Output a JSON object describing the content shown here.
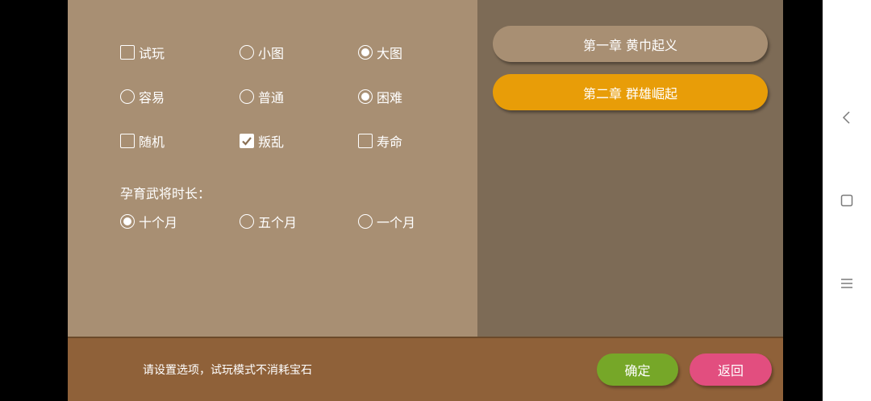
{
  "options": {
    "row1": [
      {
        "label": "试玩",
        "type": "checkbox",
        "checked": false
      },
      {
        "label": "小图",
        "type": "radio",
        "checked": false
      },
      {
        "label": "大图",
        "type": "radio",
        "checked": true
      }
    ],
    "row2": [
      {
        "label": "容易",
        "type": "radio",
        "checked": false
      },
      {
        "label": "普通",
        "type": "radio",
        "checked": false
      },
      {
        "label": "困难",
        "type": "radio",
        "checked": true
      }
    ],
    "row3": [
      {
        "label": "随机",
        "type": "checkbox",
        "checked": false
      },
      {
        "label": "叛乱",
        "type": "checkbox",
        "checked": true
      },
      {
        "label": "寿命",
        "type": "checkbox",
        "checked": false
      }
    ],
    "breeding_label": "孕育武将时长：",
    "row4": [
      {
        "label": "十个月",
        "type": "radio",
        "checked": true
      },
      {
        "label": "五个月",
        "type": "radio",
        "checked": false
      },
      {
        "label": "一个月",
        "type": "radio",
        "checked": false
      }
    ]
  },
  "chapters": [
    {
      "label": "第一章 黄巾起义",
      "selected": false
    },
    {
      "label": "第二章 群雄崛起",
      "selected": true
    }
  ],
  "footer": {
    "hint": "请设置选项，试玩模式不消耗宝石",
    "confirm_label": "确定",
    "back_label": "返回"
  },
  "colors": {
    "options_bg": "#a88f73",
    "chapter_panel_bg": "#7d6b56",
    "footer_bg": "#8f6139",
    "selected_chapter": "#e89d08",
    "confirm": "#76a728",
    "back": "#e24e7f"
  },
  "system_nav": [
    "back-icon",
    "home-icon",
    "menu-icon"
  ]
}
